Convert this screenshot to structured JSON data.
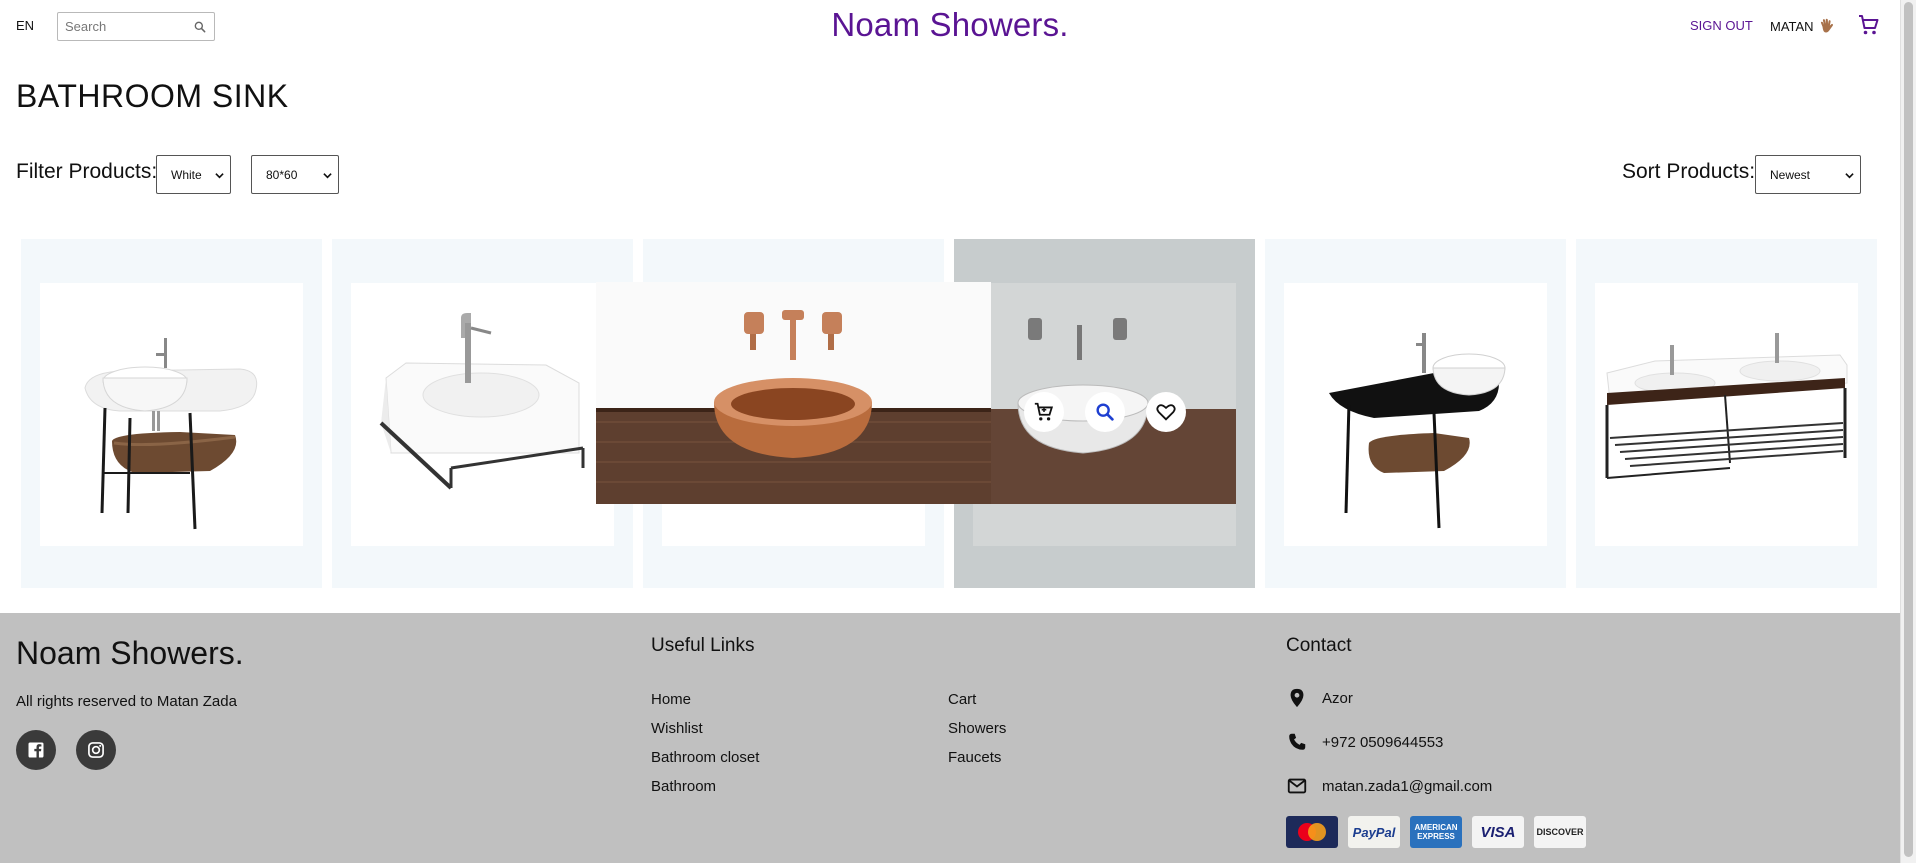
{
  "nav": {
    "language": "EN",
    "search_placeholder": "Search",
    "brand": "Noam Showers.",
    "signout_label": "SIGN OUT",
    "username": "MATAN"
  },
  "page": {
    "title": "BATHROOM SINK"
  },
  "filters": {
    "label": "Filter Products:",
    "color_selected": "White",
    "size_selected": "80*60",
    "sort_label": "Sort Products:",
    "sort_selected": "Newest"
  },
  "products": [
    {
      "name": "sink-with-wood-shelf-stand",
      "hovered": false
    },
    {
      "name": "wall-mounted-square-sink",
      "hovered": false
    },
    {
      "name": "copper-vessel-sink-on-wood-counter",
      "hovered": false
    },
    {
      "name": "white-vessel-sink-on-wood-counter",
      "hovered": true
    },
    {
      "name": "black-counter-sink-stand",
      "hovered": false
    },
    {
      "name": "double-sink-console",
      "hovered": false
    }
  ],
  "footer": {
    "brand": "Noam Showers.",
    "rights": "All rights reserved to Matan Zada",
    "links_heading": "Useful Links",
    "links_col1": [
      "Home",
      "Wishlist",
      "Bathroom closet",
      "Bathroom"
    ],
    "links_col2": [
      "Cart",
      "Showers",
      "Faucets"
    ],
    "contact_heading": "Contact",
    "contact": {
      "location": "Azor",
      "phone": "+972 0509644553",
      "email": "matan.zada1@gmail.com"
    },
    "payments": {
      "paypal": "PayPal",
      "amex": "AMERICAN EXPRESS",
      "visa": "VISA",
      "discover": "DISCOVER"
    }
  },
  "colors": {
    "brand_purple": "#5a1493",
    "footer_bg": "#c0c0c0",
    "card_bg": "#f3f8fb"
  },
  "icons": {
    "search": "search-icon",
    "cart": "cart-icon",
    "wave": "waving-hand-icon",
    "facebook": "facebook-icon",
    "instagram": "instagram-icon",
    "location": "location-pin-icon",
    "phone": "phone-icon",
    "email": "mail-icon",
    "add_to_cart": "add-to-cart-icon",
    "quick_view": "quick-view-icon",
    "wishlist": "heart-icon"
  }
}
